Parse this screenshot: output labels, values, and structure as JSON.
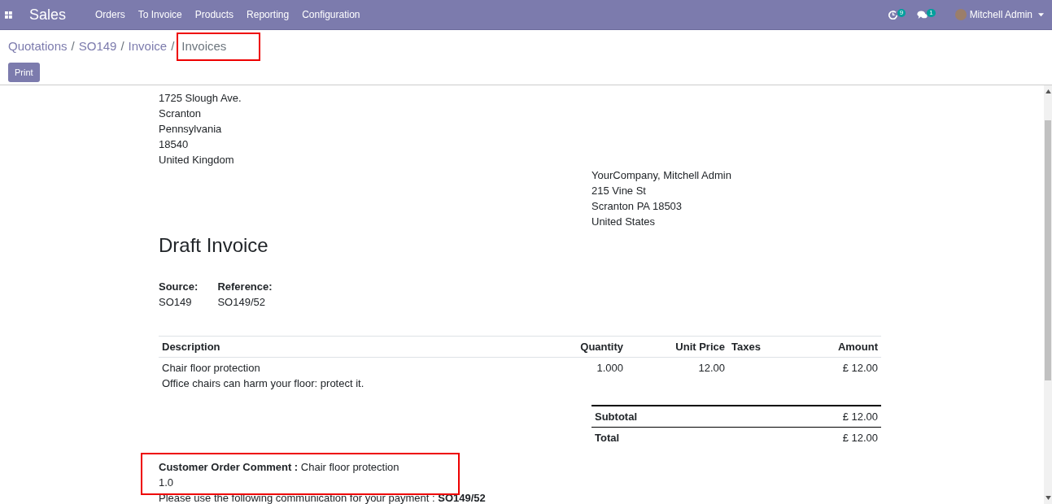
{
  "navbar": {
    "app_name": "Sales",
    "menu": [
      "Orders",
      "To Invoice",
      "Products",
      "Reporting",
      "Configuration"
    ],
    "activity_count": "9",
    "message_count": "1",
    "user_name": "Mitchell Admin"
  },
  "breadcrumb": [
    {
      "label": "Quotations",
      "highlight": false
    },
    {
      "separator": "/",
      "label": "SO149",
      "highlight": false
    },
    {
      "separator": "/",
      "label": "Invoice",
      "highlight": false
    },
    {
      "separator": "/",
      "label": "Invoices",
      "highlight": true
    }
  ],
  "print_button": "Print",
  "company_address": [
    "1725 Slough Ave.",
    "Scranton",
    "Pennsylvania",
    "18540",
    "United Kingdom"
  ],
  "partner_address": [
    "YourCompany, Mitchell Admin",
    "215 Vine St",
    "Scranton PA 18503",
    "United States"
  ],
  "title": "Draft Invoice",
  "info": [
    {
      "label": "Source:",
      "value": "SO149"
    },
    {
      "label": "Reference:",
      "value": "SO149/52"
    }
  ],
  "table": {
    "columns": [
      "Description",
      "Quantity",
      "Unit Price",
      "Taxes",
      "Amount"
    ],
    "rows": [
      {
        "description": "Chair floor protection",
        "note": "Office chairs can harm your floor: protect it.",
        "quantity": "1.000",
        "unit_price": "12.00",
        "amount": "£ 12.00"
      }
    ]
  },
  "totals": [
    {
      "label": "Subtotal",
      "value": "£ 12.00"
    },
    {
      "label": "Total",
      "value": "£ 12.00"
    }
  ],
  "comment": {
    "text": "**Customer Order Comment :** Chair floor protection",
    "second_line": "1.0",
    "highlight": true
  },
  "payment_note": "Please use the following communication for your payment : **SO149/52**"
}
